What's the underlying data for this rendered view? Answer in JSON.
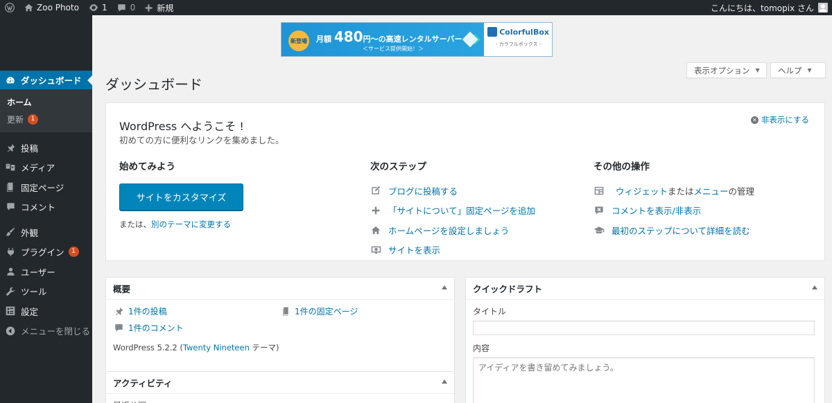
{
  "adminbar": {
    "site_name": "Zoo Photo",
    "updates_count": "1",
    "comments_count": "0",
    "new_label": "新規",
    "greeting": "こんにちは、tomopix さん"
  },
  "sidebar": {
    "dashboard": "ダッシュボード",
    "submenu": {
      "home": "ホーム",
      "updates": "更新",
      "updates_badge": "1"
    },
    "items": [
      {
        "label": "投稿",
        "icon": "pin-icon"
      },
      {
        "label": "メディア",
        "icon": "media-icon"
      },
      {
        "label": "固定ページ",
        "icon": "page-icon"
      },
      {
        "label": "コメント",
        "icon": "comment-icon"
      },
      {
        "label": "外観",
        "icon": "brush-icon"
      },
      {
        "label": "プラグイン",
        "icon": "plugin-icon",
        "badge": "1"
      },
      {
        "label": "ユーザー",
        "icon": "user-icon"
      },
      {
        "label": "ツール",
        "icon": "wrench-icon"
      },
      {
        "label": "設定",
        "icon": "settings-icon"
      },
      {
        "label": "メニューを閉じる",
        "icon": "collapse-icon"
      }
    ]
  },
  "banner": {
    "badge": "新登場",
    "prefix": "月額",
    "price": "480",
    "suffix": "円～の高速レンタルサーバー",
    "sub": "＜サービス提供開始！＞",
    "brand": "ColorfulBox",
    "brand_sub": "- カラフルボックス -"
  },
  "header": {
    "screen_options": "表示オプション",
    "help": "ヘルプ",
    "page_title": "ダッシュボード"
  },
  "welcome": {
    "title": "WordPress へようこそ !",
    "about": "初めての方に便利なリンクを集めました。",
    "dismiss": "非表示にする",
    "col1": {
      "heading": "始めてみよう",
      "button": "サイトをカスタマイズ",
      "or_text": "または、",
      "change_theme": "別のテーマに変更する"
    },
    "col2": {
      "heading": "次のステップ",
      "links": [
        {
          "label": "ブログに投稿する",
          "icon": "edit-icon"
        },
        {
          "label": "「サイトについて」固定ページを追加",
          "icon": "plus-icon"
        },
        {
          "label": "ホームページを設定しましょう",
          "icon": "home-icon"
        },
        {
          "label": "サイトを表示",
          "icon": "view-icon"
        }
      ]
    },
    "col3": {
      "heading": "その他の操作",
      "widgets_link": "ウィジェット",
      "widgets_or": "または",
      "menus_link": "メニュー",
      "menus_suffix": "の管理",
      "comments_link": "コメントを表示/非表示",
      "learn_link": "最初のステップについて詳細を読む"
    }
  },
  "glance": {
    "title": "概要",
    "posts": "1件の投稿",
    "pages": "1件の固定ページ",
    "comments": "1件のコメント",
    "version_prefix": "WordPress 5.2.2 (",
    "theme": "Twenty Nineteen",
    "version_suffix": " テーマ)"
  },
  "activity": {
    "title": "アクティビティ",
    "sub": "最近公開"
  },
  "quickdraft": {
    "title": "クイックドラフト",
    "title_label": "タイトル",
    "content_label": "内容",
    "content_placeholder": "アイディアを書き留めてみましょう。"
  }
}
